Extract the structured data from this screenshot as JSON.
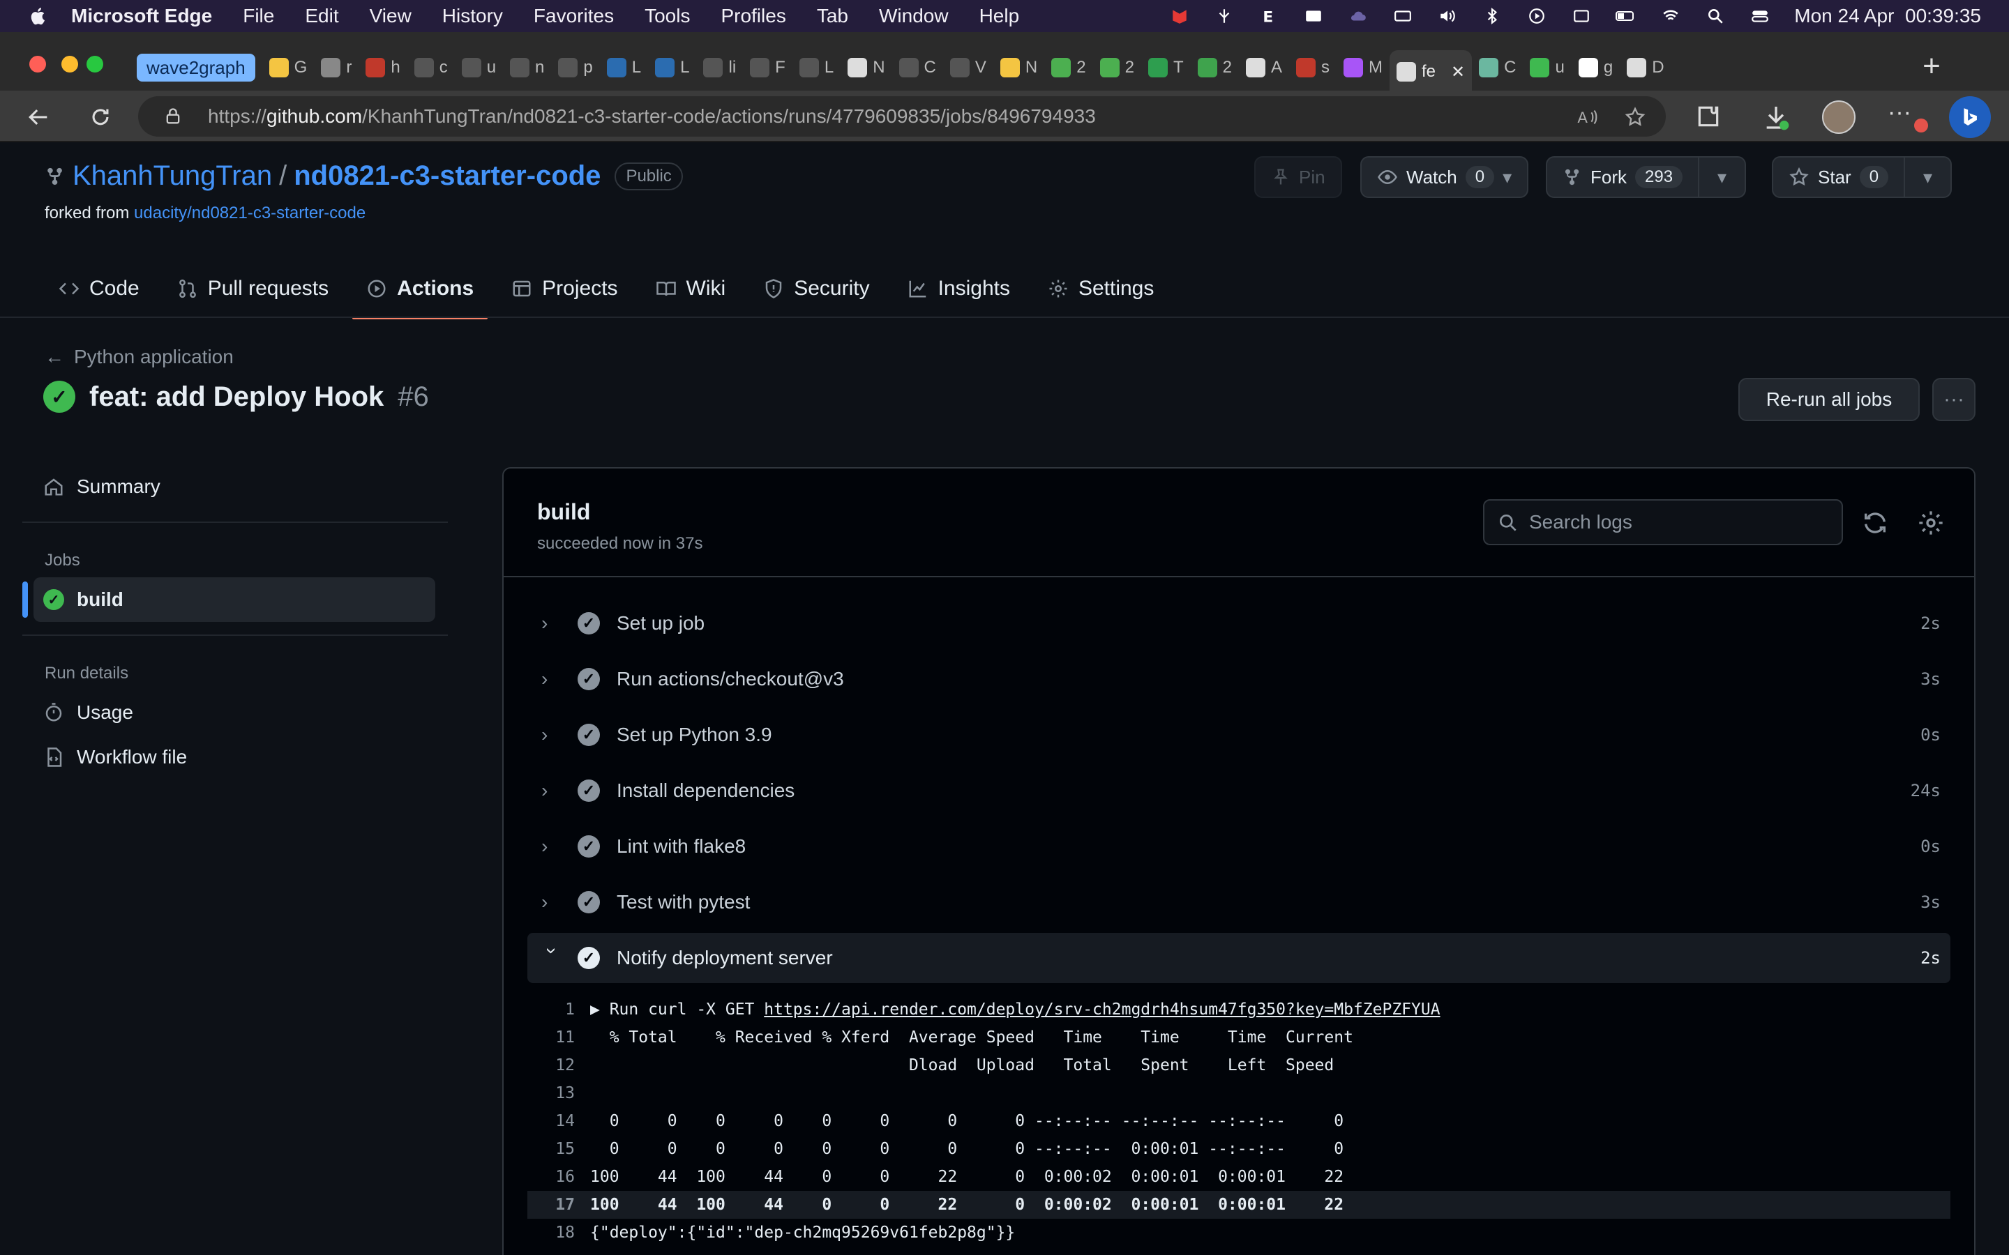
{
  "menubar": {
    "app": "Microsoft Edge",
    "items": [
      "File",
      "Edit",
      "View",
      "History",
      "Favorites",
      "Tools",
      "Profiles",
      "Tab",
      "Window",
      "Help"
    ],
    "datetime": "Mon 24 Apr  00:39:35"
  },
  "browser": {
    "tab_group_label": "wave2graph",
    "tabs": [
      {
        "icon": "lightbulb-icon",
        "label": "G",
        "color": "#f4c542"
      },
      {
        "icon": "github-icon",
        "label": "r",
        "color": "#888888"
      },
      {
        "icon": "pdf-icon",
        "label": "h",
        "color": "#c0392b"
      },
      {
        "icon": "github-icon",
        "label": "c",
        "color": "#555555"
      },
      {
        "icon": "github-icon",
        "label": "u",
        "color": "#555555"
      },
      {
        "icon": "github-icon",
        "label": "n",
        "color": "#555555"
      },
      {
        "icon": "github-icon",
        "label": "p",
        "color": "#555555"
      },
      {
        "icon": "ucla-icon",
        "label": "L",
        "color": "#2b6cb0"
      },
      {
        "icon": "ucla-icon",
        "label": "L",
        "color": "#2b6cb0"
      },
      {
        "icon": "github-icon",
        "label": "li",
        "color": "#555555"
      },
      {
        "icon": "github-icon",
        "label": "F",
        "color": "#555555"
      },
      {
        "icon": "github-icon",
        "label": "L",
        "color": "#555555"
      },
      {
        "icon": "notion-icon",
        "label": "N",
        "color": "#dddddd"
      },
      {
        "icon": "github-icon",
        "label": "C",
        "color": "#555555"
      },
      {
        "icon": "github-icon",
        "label": "V",
        "color": "#555555"
      },
      {
        "icon": "hand-icon",
        "label": "N",
        "color": "#f4c542"
      },
      {
        "icon": "green-face-icon",
        "label": "2",
        "color": "#4caf50"
      },
      {
        "icon": "green-face-icon",
        "label": "2",
        "color": "#4caf50"
      },
      {
        "icon": "plus-green-icon",
        "label": "T",
        "color": "#2e9e4f"
      },
      {
        "icon": "leaf-icon",
        "label": "2",
        "color": "#3fa34d"
      },
      {
        "icon": "notion-icon",
        "label": "A",
        "color": "#dddddd"
      },
      {
        "icon": "pdf-icon",
        "label": "s",
        "color": "#c0392b"
      },
      {
        "icon": "messenger-icon",
        "label": "M",
        "color": "#a855f7"
      },
      {
        "icon": "github-icon",
        "label": "fe",
        "color": "#dddddd",
        "active": true
      },
      {
        "icon": "openai-icon",
        "label": "C",
        "color": "#6bb7a0"
      },
      {
        "icon": "green-box-icon",
        "label": "u",
        "color": "#3fb950"
      },
      {
        "icon": "google-icon",
        "label": "g",
        "color": "#ffffff"
      },
      {
        "icon": "github-icon",
        "label": "D",
        "color": "#dddddd"
      }
    ],
    "url_prefix": "https://",
    "url_host": "github.com",
    "url_path": "/KhanhTungTran/nd0821-c3-starter-code/actions/runs/4779609835/jobs/8496794933"
  },
  "repo": {
    "owner": "KhanhTungTran",
    "separator": "/",
    "name": "nd0821-c3-starter-code",
    "visibility": "Public",
    "forked_prefix": "forked from",
    "forked_from": "udacity/nd0821-c3-starter-code",
    "pin_label": "Pin",
    "watch_label": "Watch",
    "watch_count": "0",
    "fork_label": "Fork",
    "fork_count": "293",
    "star_label": "Star",
    "star_count": "0"
  },
  "nav": {
    "tabs": [
      {
        "label": "Code",
        "icon": "code-icon"
      },
      {
        "label": "Pull requests",
        "icon": "pull-request-icon"
      },
      {
        "label": "Actions",
        "icon": "play-icon",
        "selected": true
      },
      {
        "label": "Projects",
        "icon": "table-icon"
      },
      {
        "label": "Wiki",
        "icon": "book-icon"
      },
      {
        "label": "Security",
        "icon": "shield-icon"
      },
      {
        "label": "Insights",
        "icon": "graph-icon"
      },
      {
        "label": "Settings",
        "icon": "gear-icon"
      }
    ]
  },
  "run": {
    "back_label": "Python application",
    "title": "feat: add Deploy Hook",
    "number": "#6",
    "rerun_label": "Re-run all jobs"
  },
  "sidebar": {
    "summary": "Summary",
    "jobs_heading": "Jobs",
    "job": "build",
    "run_details_heading": "Run details",
    "usage": "Usage",
    "workflow_file": "Workflow file"
  },
  "job": {
    "name": "build",
    "status": "succeeded now in 37s",
    "search_placeholder": "Search logs",
    "steps": [
      {
        "name": "Set up job",
        "duration": "2s"
      },
      {
        "name": "Run actions/checkout@v3",
        "duration": "3s"
      },
      {
        "name": "Set up Python 3.9",
        "duration": "0s"
      },
      {
        "name": "Install dependencies",
        "duration": "24s"
      },
      {
        "name": "Lint with flake8",
        "duration": "0s"
      },
      {
        "name": "Test with pytest",
        "duration": "3s"
      },
      {
        "name": "Notify deployment server",
        "duration": "2s",
        "expanded": true
      }
    ],
    "log_lines": [
      {
        "n": "1",
        "prefix": "▶ Run curl -X GET ",
        "link": "https://api.render.com/deploy/srv-ch2mgdrh4hsum47fg350?key=MbfZePZFYUA"
      },
      {
        "n": "11",
        "text": "  % Total    % Received % Xferd  Average Speed   Time    Time     Time  Current"
      },
      {
        "n": "12",
        "text": "                                 Dload  Upload   Total   Spent    Left  Speed"
      },
      {
        "n": "13",
        "text": ""
      },
      {
        "n": "14",
        "text": "  0     0    0     0    0     0      0      0 --:--:-- --:--:-- --:--:--     0"
      },
      {
        "n": "15",
        "text": "  0     0    0     0    0     0      0      0 --:--:--  0:00:01 --:--:--     0"
      },
      {
        "n": "16",
        "text": "100    44  100    44    0     0     22      0  0:00:02  0:00:01  0:00:01    22"
      },
      {
        "n": "17",
        "text": "100    44  100    44    0     0     22      0  0:00:02  0:00:01  0:00:01    22",
        "highlight": true
      },
      {
        "n": "18",
        "text": "{\"deploy\":{\"id\":\"dep-ch2mq95269v61feb2p8g\"}}"
      }
    ]
  }
}
